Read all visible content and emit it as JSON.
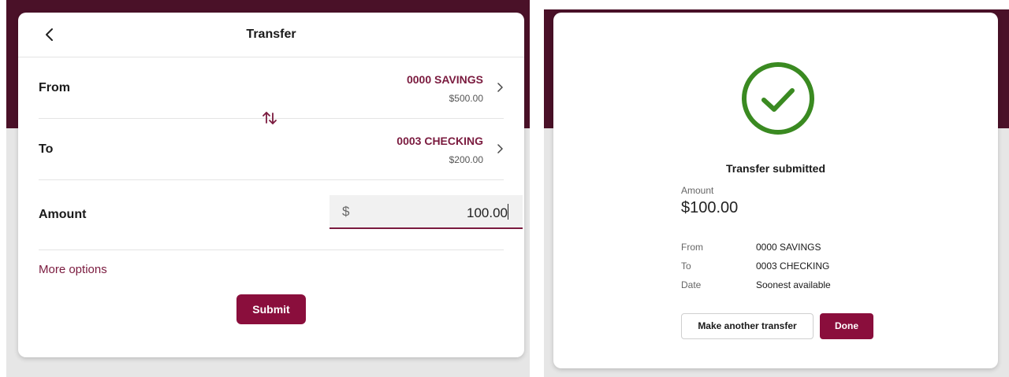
{
  "transfer_form": {
    "title": "Transfer",
    "from_label": "From",
    "to_label": "To",
    "amount_label": "Amount",
    "from_account": {
      "name": "0000 SAVINGS",
      "balance": "$500.00"
    },
    "to_account": {
      "name": "0003 CHECKING",
      "balance": "$200.00"
    },
    "currency_symbol": "$",
    "amount_value": "100.00",
    "more_options": "More options",
    "submit_label": "Submit"
  },
  "confirmation": {
    "title": "Transfer submitted",
    "amount_label": "Amount",
    "amount_value": "$100.00",
    "details": [
      {
        "label": "From",
        "value": "0000 SAVINGS"
      },
      {
        "label": "To",
        "value": "0003 CHECKING"
      },
      {
        "label": "Date",
        "value": "Soonest available"
      }
    ],
    "make_another_label": "Make another transfer",
    "done_label": "Done"
  },
  "icons": {
    "back": "chevron-left-icon",
    "account_chevron": "chevron-right-icon",
    "swap": "swap-vertical-icon",
    "success": "check-circle-icon"
  },
  "colors": {
    "brand_dark": "#4a1128",
    "accent": "#7a1a3e",
    "button": "#8a0e3c",
    "success": "#3a8a21"
  }
}
